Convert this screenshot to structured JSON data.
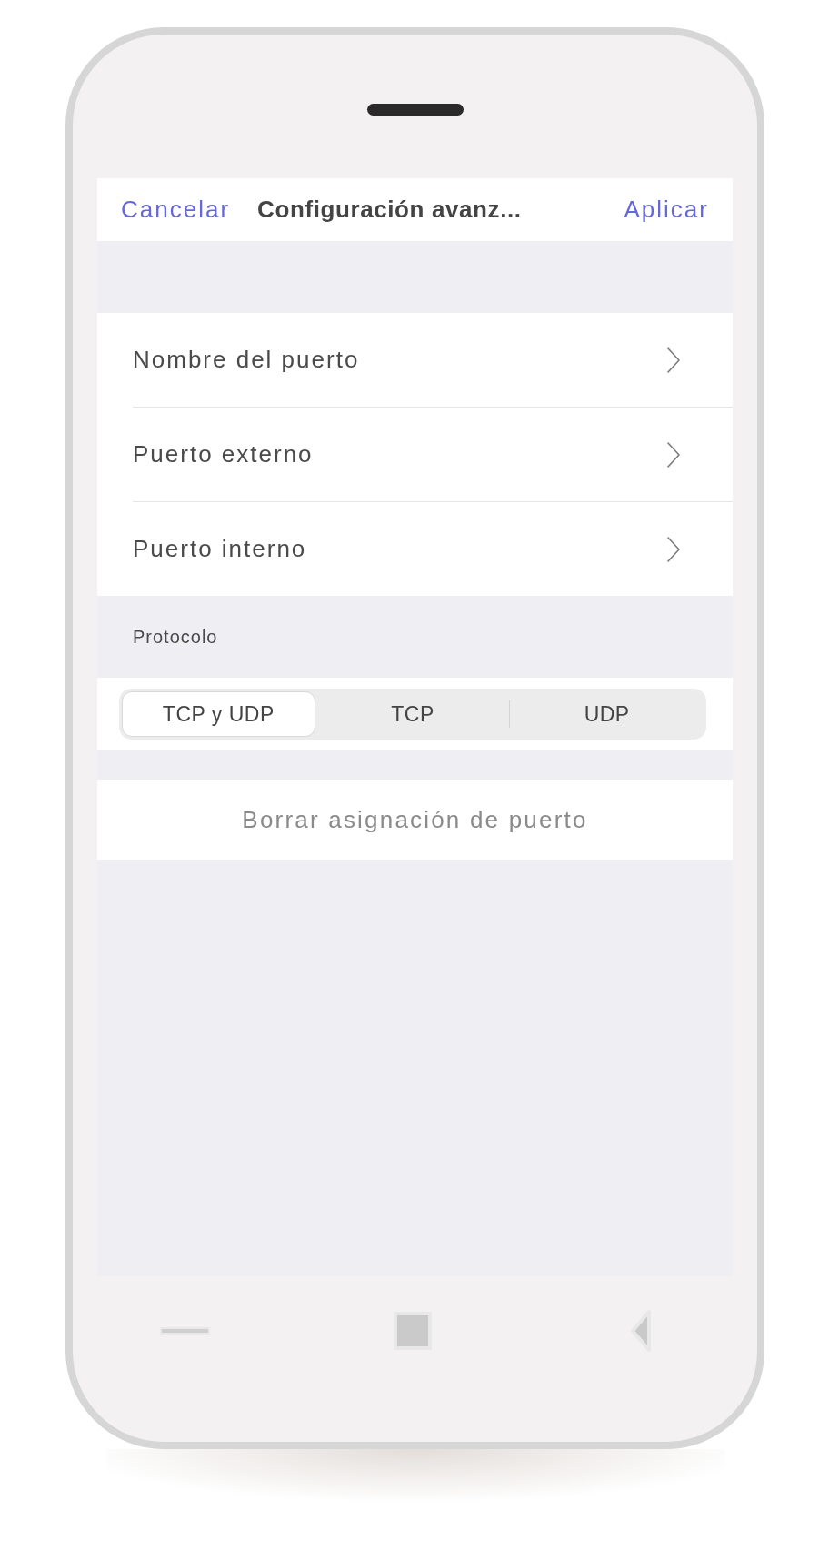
{
  "header": {
    "cancel": "Cancelar",
    "title": "Configuración avanz...",
    "apply": "Aplicar"
  },
  "settings": [
    {
      "label": "Nombre del puerto"
    },
    {
      "label": "Puerto externo"
    },
    {
      "label": "Puerto interno"
    }
  ],
  "protocol": {
    "label": "Protocolo",
    "options": [
      {
        "label": "TCP y UDP",
        "selected": true
      },
      {
        "label": "TCP",
        "selected": false
      },
      {
        "label": "UDP",
        "selected": false
      }
    ]
  },
  "delete_button": "Borrar asignación de puerto"
}
